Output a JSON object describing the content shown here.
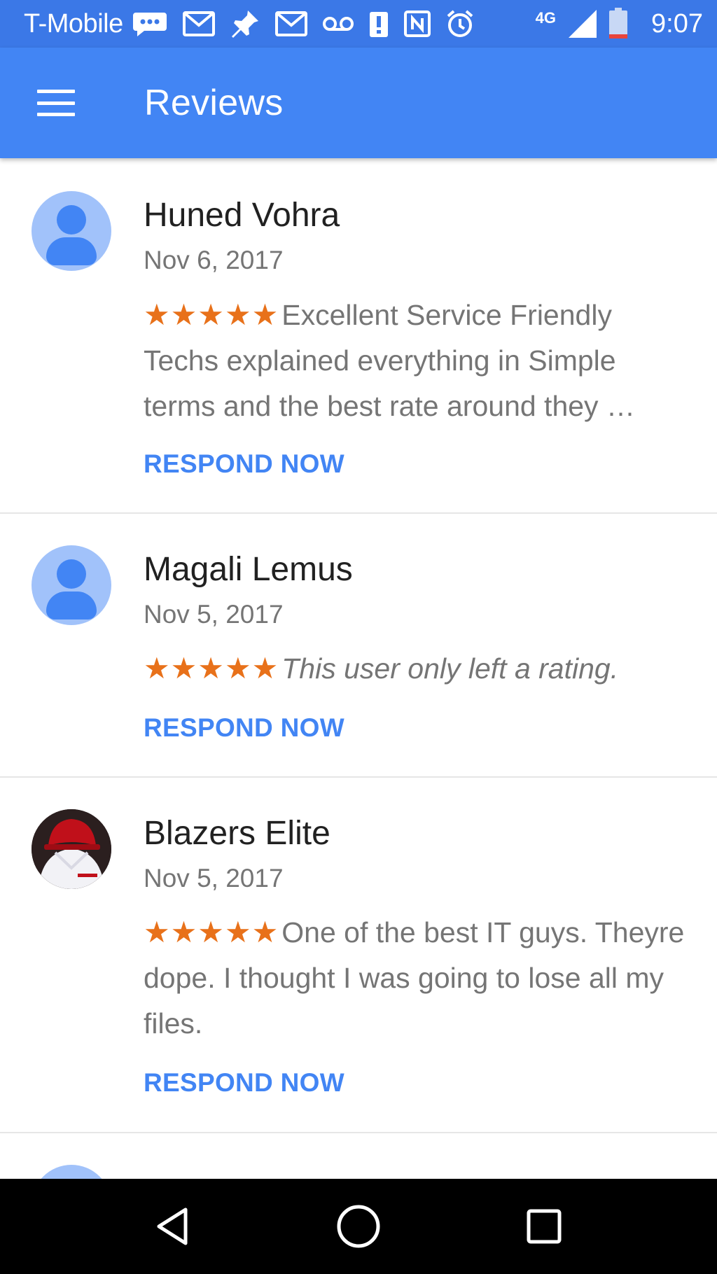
{
  "status_bar": {
    "carrier": "T-Mobile",
    "network": "4G",
    "time": "9:07",
    "icons": [
      "message-icon",
      "gmail-icon",
      "pin-icon",
      "gmail-icon",
      "voicemail-icon",
      "alert-icon",
      "nfc-icon",
      "alarm-icon",
      "signal-icon",
      "battery-icon"
    ]
  },
  "app_bar": {
    "title": "Reviews",
    "menu_icon": "hamburger-menu-icon"
  },
  "reviews": [
    {
      "name": "Huned Vohra",
      "date": "Nov 6, 2017",
      "stars": "★★★★★",
      "rating": 5,
      "text": "Excellent Service Friendly Techs explained everything in Simple terms and the best rate around they …",
      "italic": false,
      "action": "RESPOND NOW",
      "avatar": "default-avatar"
    },
    {
      "name": "Magali Lemus",
      "date": "Nov 5, 2017",
      "stars": "★★★★★",
      "rating": 5,
      "text": "This user only left a rating.",
      "italic": true,
      "action": "RESPOND NOW",
      "avatar": "default-avatar"
    },
    {
      "name": "Blazers Elite",
      "date": "Nov 5, 2017",
      "stars": "★★★★★",
      "rating": 5,
      "text": "One of the best IT guys. Theyre dope. I thought I was going to lose all my files.",
      "italic": false,
      "action": "RESPOND NOW",
      "avatar": "photo-avatar"
    }
  ],
  "nav_bar": {
    "buttons": [
      "back-icon",
      "home-icon",
      "recents-icon"
    ]
  },
  "colors": {
    "status_bar": "#3b78e7",
    "app_bar": "#4285f4",
    "star": "#e8711a",
    "link": "#4285f4",
    "avatar_bg": "#a1c2fa"
  }
}
